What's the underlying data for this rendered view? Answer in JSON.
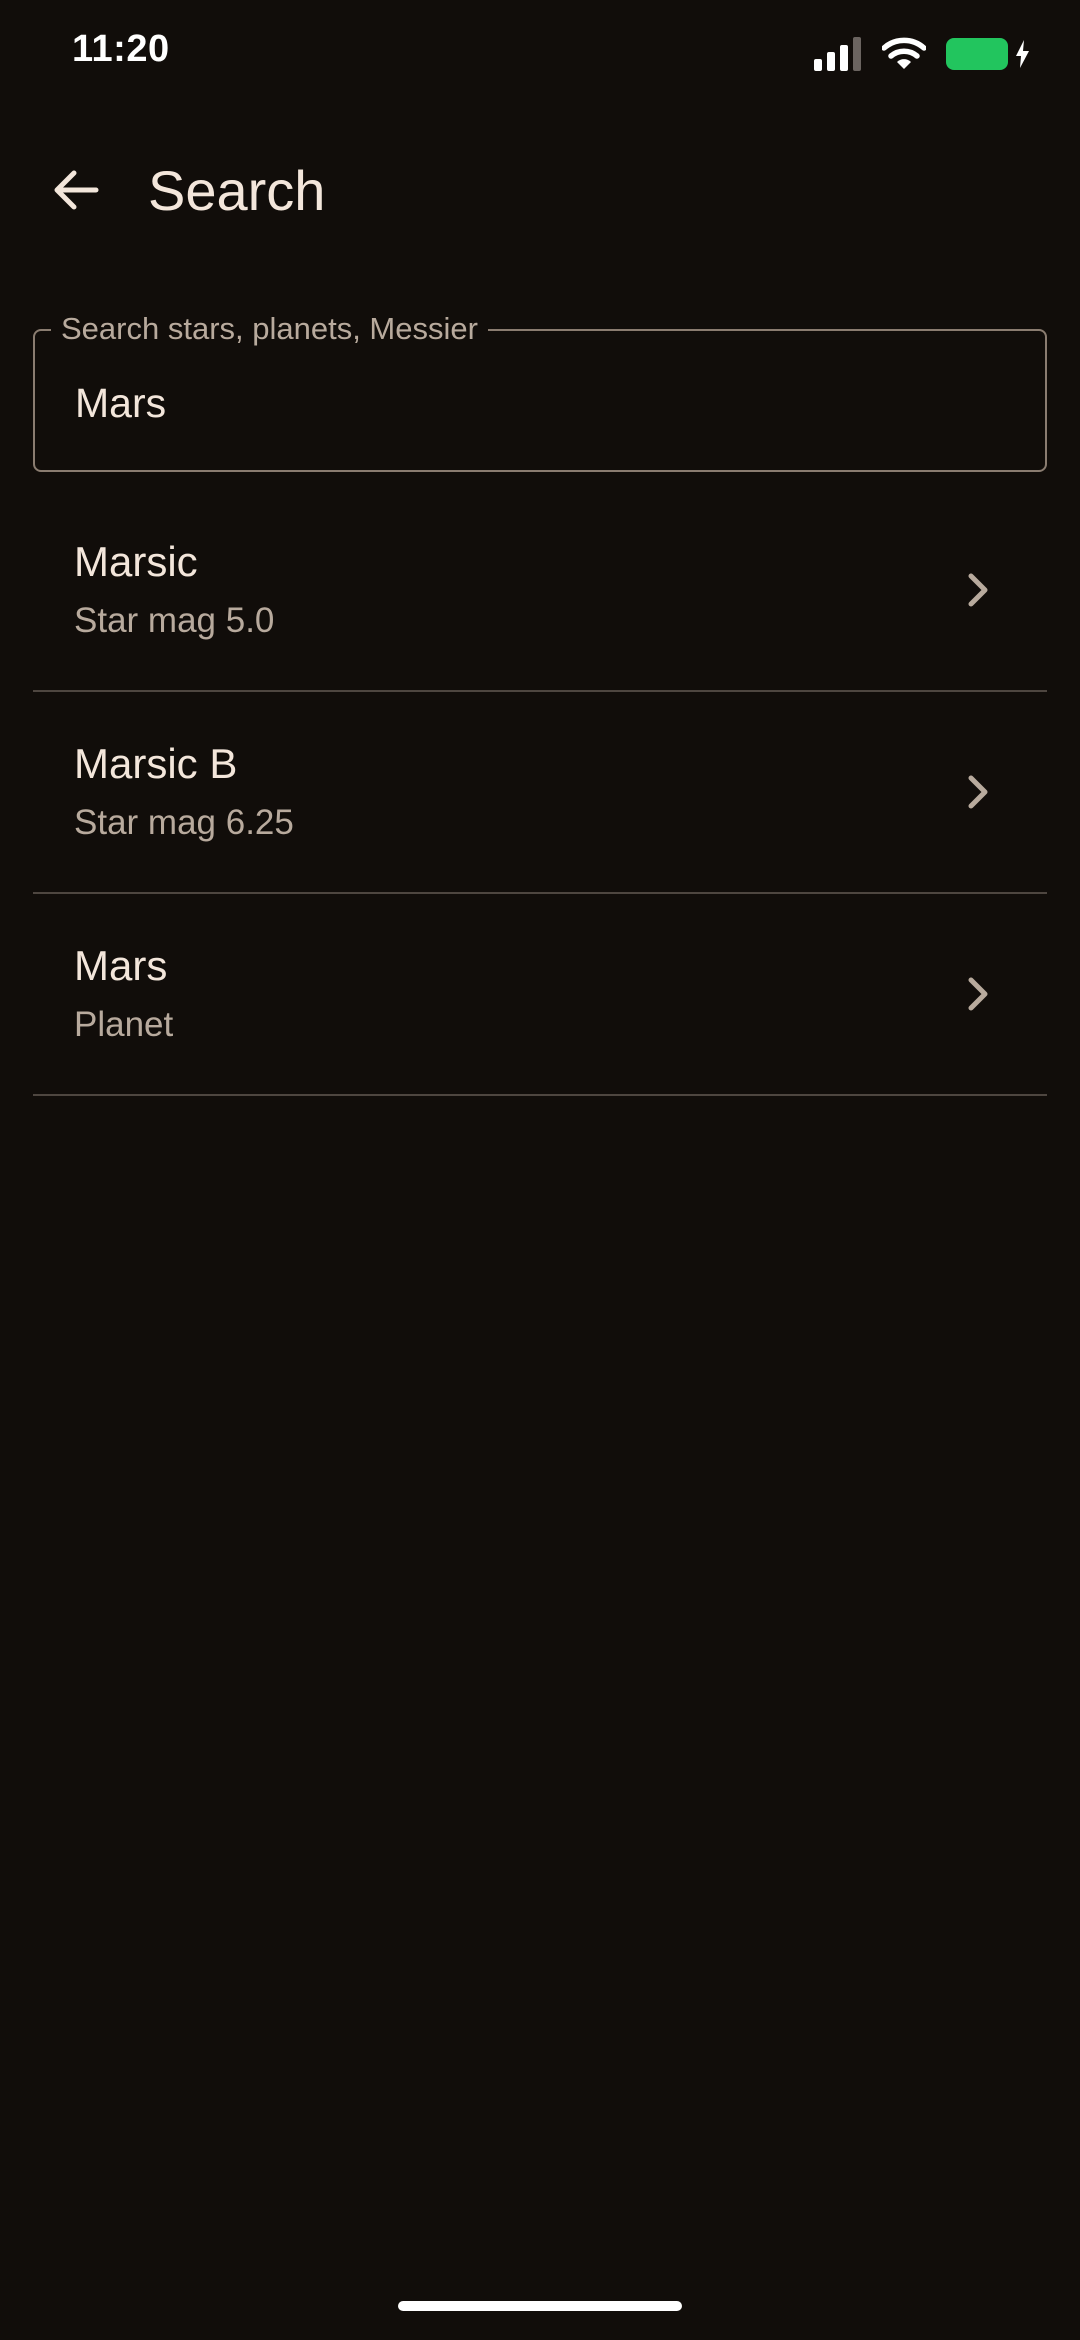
{
  "status_bar": {
    "time": "11:20",
    "icons": [
      "cellular-signal-icon",
      "wifi-icon",
      "battery-charging-icon"
    ],
    "battery_color": "#22c55e"
  },
  "app_bar": {
    "title": "Search",
    "back_icon": "arrow-left-icon"
  },
  "search": {
    "label": "Search stars, planets, Messier",
    "value": "Mars"
  },
  "results": [
    {
      "name": "Marsic",
      "subtitle": "Star mag 5.0"
    },
    {
      "name": "Marsic B",
      "subtitle": "Star mag 6.25"
    },
    {
      "name": "Mars",
      "subtitle": "Planet"
    }
  ],
  "colors": {
    "background": "#110d0a",
    "text_primary": "#f3e6db",
    "text_secondary": "#b8aa9d",
    "divider": "#4e4640",
    "outline": "#8a7c70"
  }
}
